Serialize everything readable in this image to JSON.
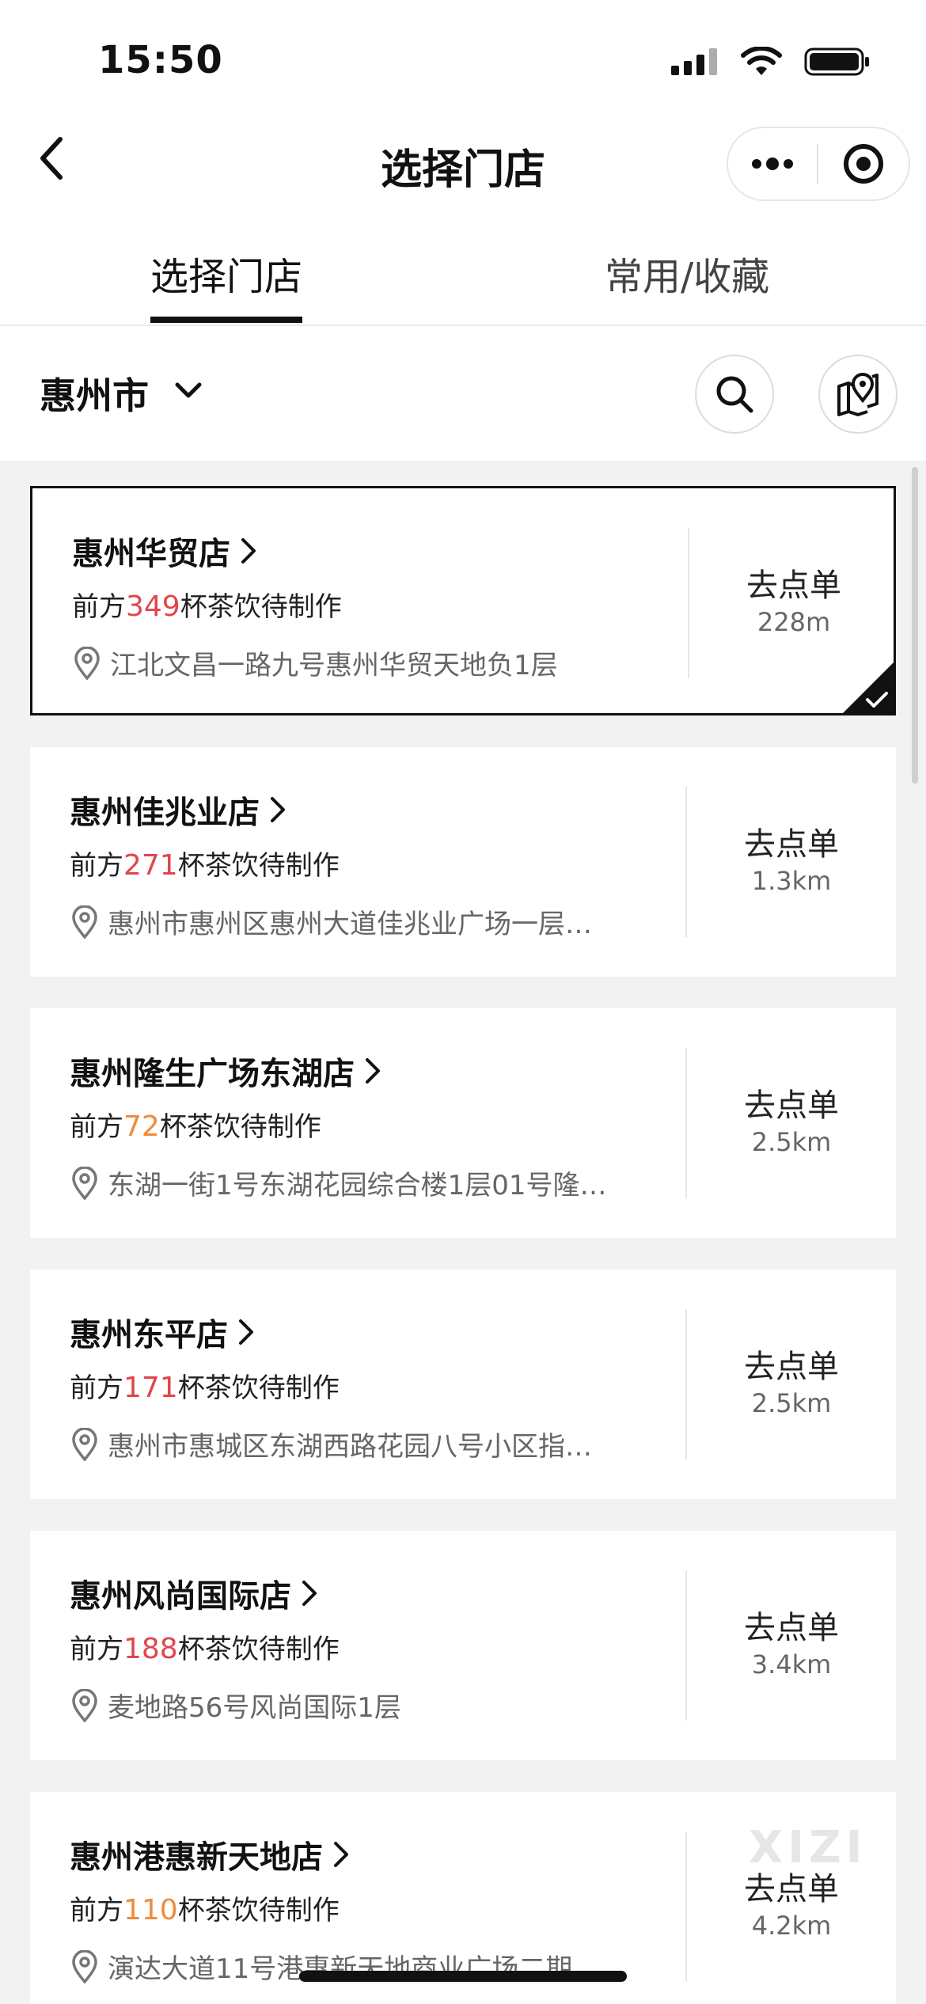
{
  "status_bar": {
    "time": "15:50"
  },
  "nav": {
    "title": "选择门店"
  },
  "tabs": [
    {
      "label": "选择门店",
      "active": true
    },
    {
      "label": "常用/收藏",
      "active": false
    }
  ],
  "city": {
    "name": "惠州市"
  },
  "stores": [
    {
      "name": "惠州华贸店",
      "queue_prefix": "前方",
      "queue_count": "349",
      "queue_suffix": "杯茶饮待制作",
      "address": "江北文昌一路九号惠州华贸天地负1层",
      "action": "去点单",
      "distance": "228m",
      "selected": true,
      "count_color": "#e0464b"
    },
    {
      "name": "惠州佳兆业店",
      "queue_prefix": "前方",
      "queue_count": "271",
      "queue_suffix": "杯茶饮待制作",
      "address": "惠州市惠州区惠州大道佳兆业广场一层…",
      "action": "去点单",
      "distance": "1.3km",
      "selected": false,
      "count_color": "#e0464b"
    },
    {
      "name": "惠州隆生广场东湖店",
      "queue_prefix": "前方",
      "queue_count": "72",
      "queue_suffix": "杯茶饮待制作",
      "address": "东湖一街1号东湖花园综合楼1层01号隆…",
      "action": "去点单",
      "distance": "2.5km",
      "selected": false,
      "count_color": "#f08b3a"
    },
    {
      "name": "惠州东平店",
      "queue_prefix": "前方",
      "queue_count": "171",
      "queue_suffix": "杯茶饮待制作",
      "address": "惠州市惠城区东湖西路花园八号小区指…",
      "action": "去点单",
      "distance": "2.5km",
      "selected": false,
      "count_color": "#e0464b"
    },
    {
      "name": "惠州风尚国际店",
      "queue_prefix": "前方",
      "queue_count": "188",
      "queue_suffix": "杯茶饮待制作",
      "address": "麦地路56号风尚国际1层",
      "action": "去点单",
      "distance": "3.4km",
      "selected": false,
      "count_color": "#e0464b"
    },
    {
      "name": "惠州港惠新天地店",
      "queue_prefix": "前方",
      "queue_count": "110",
      "queue_suffix": "杯茶饮待制作",
      "address": "演达大道11号港惠新天地商业广场二期…",
      "action": "去点单",
      "distance": "4.2km",
      "selected": false,
      "count_color": "#f08b3a"
    }
  ],
  "watermark": "XIZI"
}
